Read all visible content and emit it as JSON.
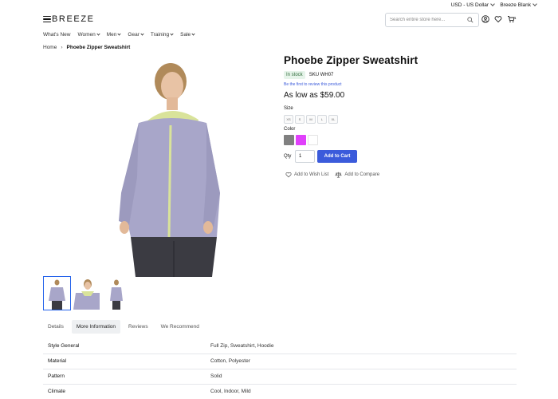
{
  "topbar": {
    "currency": "USD - US Dollar",
    "store": "Breeze Blank"
  },
  "header": {
    "logo_text": "BREEZE",
    "search": {
      "placeholder": "Search entire store here...",
      "value": ""
    },
    "cart_count": "1"
  },
  "nav": {
    "items": [
      "What's New",
      "Women",
      "Men",
      "Gear",
      "Training",
      "Sale"
    ]
  },
  "breadcrumb": {
    "home": "Home",
    "current": "Phoebe Zipper Sweatshirt"
  },
  "product": {
    "title": "Phoebe Zipper Sweatshirt",
    "stock": "In stock",
    "sku": "SKU WH07",
    "review_link": "Be the first to review this product",
    "price": "As low as $59.00",
    "size_label": "Size",
    "sizes": [
      "XS",
      "S",
      "M",
      "L",
      "XL"
    ],
    "color_label": "Color",
    "colors": [
      "#808080",
      "#e040fb",
      "#ffffff"
    ],
    "qty_label": "Qty",
    "qty_value": "1",
    "add_to_cart": "Add to Cart",
    "wishlist": "Add to Wish List",
    "compare": "Add to Compare"
  },
  "tabs": [
    "Details",
    "More Information",
    "Reviews",
    "We Recommend"
  ],
  "specs": [
    {
      "key": "Style General",
      "value": "Full Zip, Sweatshirt, Hoodie"
    },
    {
      "key": "Material",
      "value": "Cotton, Polyester"
    },
    {
      "key": "Pattern",
      "value": "Solid"
    },
    {
      "key": "Climate",
      "value": "Cool, Indoor, Mild"
    }
  ],
  "colors": {
    "accent": "#3b5bdb",
    "instock_bg": "#e6f4ea",
    "instock_text": "#2f6b3a"
  }
}
